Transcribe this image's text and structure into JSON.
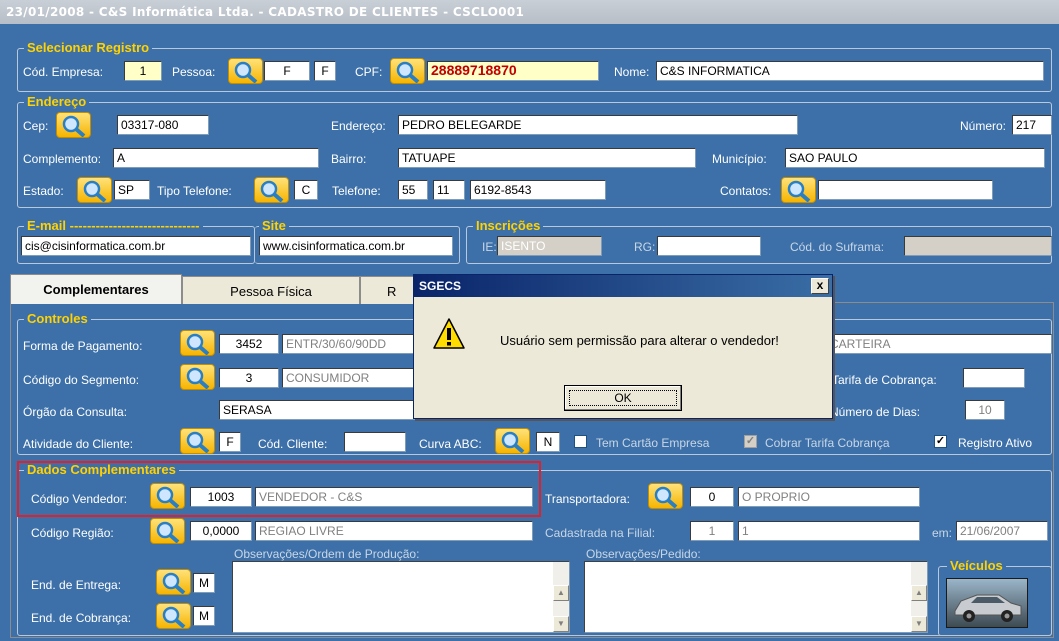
{
  "window": {
    "title": "23/01/2008  -  C&S Informática Ltda.  -  CADASTRO DE CLIENTES  -  CSCLO001"
  },
  "selecionar": {
    "legend": "Selecionar Registro",
    "cod_empresa_label": "Cód. Empresa:",
    "cod_empresa_value": "1",
    "pessoa_label": "Pessoa:",
    "pessoa_value1": "F",
    "pessoa_value2": "F",
    "cpf_label": "CPF:",
    "cpf_value": "28889718870",
    "nome_label": "Nome:",
    "nome_value": "C&S INFORMATICA"
  },
  "endereco": {
    "legend": "Endereço",
    "cep_label": "Cep:",
    "cep_value": "03317-080",
    "endereco_label": "Endereço:",
    "endereco_value": "PEDRO BELEGARDE",
    "numero_label": "Número:",
    "numero_value": "217",
    "complemento_label": "Complemento:",
    "complemento_value": "A",
    "bairro_label": "Bairro:",
    "bairro_value": "TATUAPE",
    "municipio_label": "Município:",
    "municipio_value": "SAO PAULO",
    "estado_label": "Estado:",
    "estado_value": "SP",
    "tipo_tel_label": "Tipo Telefone:",
    "tipo_tel_value": "C",
    "telefone_label": "Telefone:",
    "tel_ddi": "55",
    "tel_ddd": "11",
    "tel_num": "6192-8543",
    "contatos_label": "Contatos:",
    "contatos_value": ""
  },
  "email": {
    "legend": "E-mail ------------------------------",
    "value": "cis@cisinformatica.com.br"
  },
  "site": {
    "legend": "Site",
    "value": "www.cisinformatica.com.br"
  },
  "inscricoes": {
    "legend": "Inscrições",
    "ie_label": "IE:",
    "ie_value": "ISENTO",
    "rg_label": "RG:",
    "rg_value": "",
    "suframa_label": "Cód. do Suframa:",
    "suframa_value": ""
  },
  "tabs": [
    {
      "label": "Complementares"
    },
    {
      "label": "Pessoa Física"
    },
    {
      "label": "R"
    }
  ],
  "controles": {
    "legend": "Controles",
    "forma_pag_label": "Forma de Pagamento:",
    "forma_pag_code": "3452",
    "forma_pag_desc": "ENTR/30/60/90DD",
    "carteira_value": "CARTEIRA",
    "segmento_label": "Código do Segmento:",
    "segmento_code": "3",
    "segmento_desc": "CONSUMIDOR",
    "tarifa_label": "Tarifa de Cobrança:",
    "tarifa_value": "",
    "orgao_label": "Órgão da Consulta:",
    "orgao_value": "SERASA",
    "num_dias_label": "Número de Dias:",
    "num_dias_value": "10",
    "atividade_label": "Atividade do Cliente:",
    "atividade_value": "F",
    "cod_cliente_label": "Cód. Cliente:",
    "cod_cliente_value": "",
    "curva_label": "Curva ABC:",
    "curva_value": "N",
    "tem_cartao_label": "Tem Cartão Empresa",
    "cobrar_tarifa_label": "Cobrar Tarifa Cobrança",
    "registro_ativo_label": "Registro Ativo"
  },
  "dados": {
    "legend": "Dados Complementares",
    "vendedor_label": "Código Vendedor:",
    "vendedor_code": "1003",
    "vendedor_desc": "VENDEDOR - C&S",
    "transp_label": "Transportadora:",
    "transp_code": "0",
    "transp_desc": "O PROPRIO",
    "regiao_label": "Código Região:",
    "regiao_code": "0,0000",
    "regiao_desc": "REGIAO LIVRE",
    "filial_label": "Cadastrada na Filial:",
    "filial_code": "1",
    "filial_desc": "1",
    "em_label": "em:",
    "em_value": "21/06/2007",
    "obs_ordem_label": "Observações/Ordem de Produção:",
    "obs_pedido_label": "Observações/Pedido:",
    "entrega_label": "End. de Entrega:",
    "entrega_value": "M",
    "cobranca_label": "End. de Cobrança:",
    "cobranca_value": "M",
    "veiculos_legend": "Veículos"
  },
  "dialog": {
    "title": "SGECS",
    "close": "x",
    "message": "Usuário sem permissão para alterar o vendedor!",
    "ok_label": "OK",
    "warning_icon": "warning-icon"
  },
  "colors": {
    "background": "#3d70a8",
    "legend": "#ffd200",
    "highlight": "#e0202a"
  }
}
